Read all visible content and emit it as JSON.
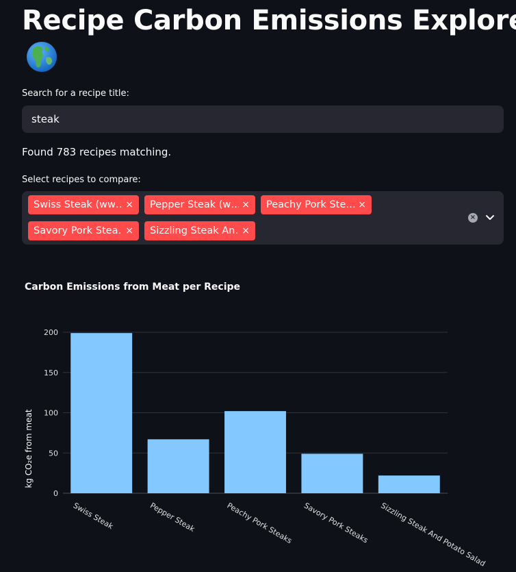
{
  "header": {
    "title": "Recipe Carbon Emissions Explorer",
    "emoji": "globe-europe-africa"
  },
  "search": {
    "label": "Search for a recipe title:",
    "value": "steak"
  },
  "status": {
    "found_text": "Found 783 recipes matching."
  },
  "select": {
    "label": "Select recipes to compare:",
    "chips": [
      "Swiss Steak (ww…",
      "Pepper Steak (w…",
      "Peachy Pork Ste…",
      "Savory Pork Stea…",
      "Sizzling Steak An…"
    ],
    "remove_glyph": "×",
    "clear_glyph": "×"
  },
  "colors": {
    "background": "#0e1117",
    "input_bg": "#262730",
    "chip": "#ff4b4b",
    "bar": "#83c9ff"
  },
  "chart_data": {
    "type": "bar",
    "title": "Carbon Emissions from Meat per Recipe",
    "ylabel": "kg CO₂e from meat",
    "xlabel": "",
    "categories": [
      "Swiss Steak",
      "Pepper Steak",
      "Peachy Pork Steaks",
      "Savory Pork Steaks",
      "Sizzling Steak And Potato Salad"
    ],
    "values": [
      199,
      67,
      102,
      49,
      22
    ],
    "ylim": [
      0,
      200
    ],
    "yticks": [
      0,
      50,
      100,
      150,
      200
    ],
    "grid": true
  }
}
